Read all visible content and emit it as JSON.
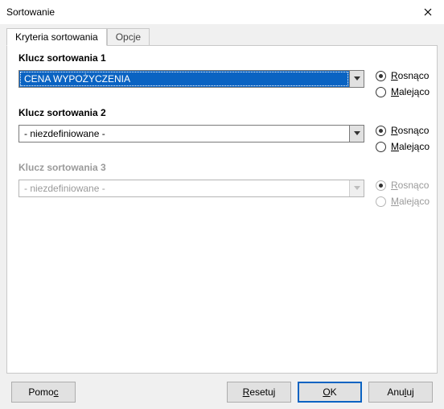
{
  "window": {
    "title": "Sortowanie"
  },
  "tabs": {
    "criteria": "Kryteria sortowania",
    "options": "Opcje"
  },
  "sort_keys": {
    "key1": {
      "label": "Klucz sortowania 1",
      "value": "CENA WYPOŻYCZENIA",
      "asc_label": "Rosnąco",
      "desc_label": "Malejąco",
      "selected": "asc",
      "enabled": true
    },
    "key2": {
      "label": "Klucz sortowania 2",
      "value": "- niezdefiniowane -",
      "asc_label": "Rosnąco",
      "desc_label": "Malejąco",
      "selected": "asc",
      "enabled": true
    },
    "key3": {
      "label": "Klucz sortowania 3",
      "value": "- niezdefiniowane -",
      "asc_label": "Rosnąco",
      "desc_label": "Malejąco",
      "selected": "asc",
      "enabled": false
    }
  },
  "buttons": {
    "help": "Pomoc",
    "reset": "Resetuj",
    "ok": "OK",
    "cancel": "Anuluj"
  }
}
